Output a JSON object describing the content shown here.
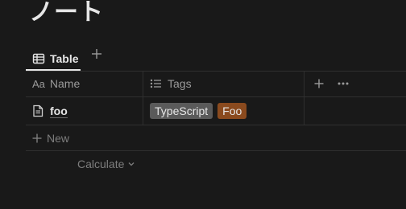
{
  "page": {
    "title": "ノート"
  },
  "views": {
    "tabs": [
      {
        "label": "Table",
        "icon": "table-icon",
        "active": true
      }
    ],
    "add_view_icon": "plus-icon"
  },
  "table": {
    "columns": [
      {
        "label": "Name",
        "icon": "text-property-icon",
        "icon_text": "Aa"
      },
      {
        "label": "Tags",
        "icon": "list-property-icon"
      }
    ],
    "rows": [
      {
        "name": "foo",
        "icon": "page-icon",
        "tags": [
          {
            "label": "TypeScript",
            "color": "#5a5a5a"
          },
          {
            "label": "Foo",
            "color": "#8a4a1e"
          }
        ]
      }
    ],
    "new_row_label": "New",
    "calculate_label": "Calculate"
  }
}
